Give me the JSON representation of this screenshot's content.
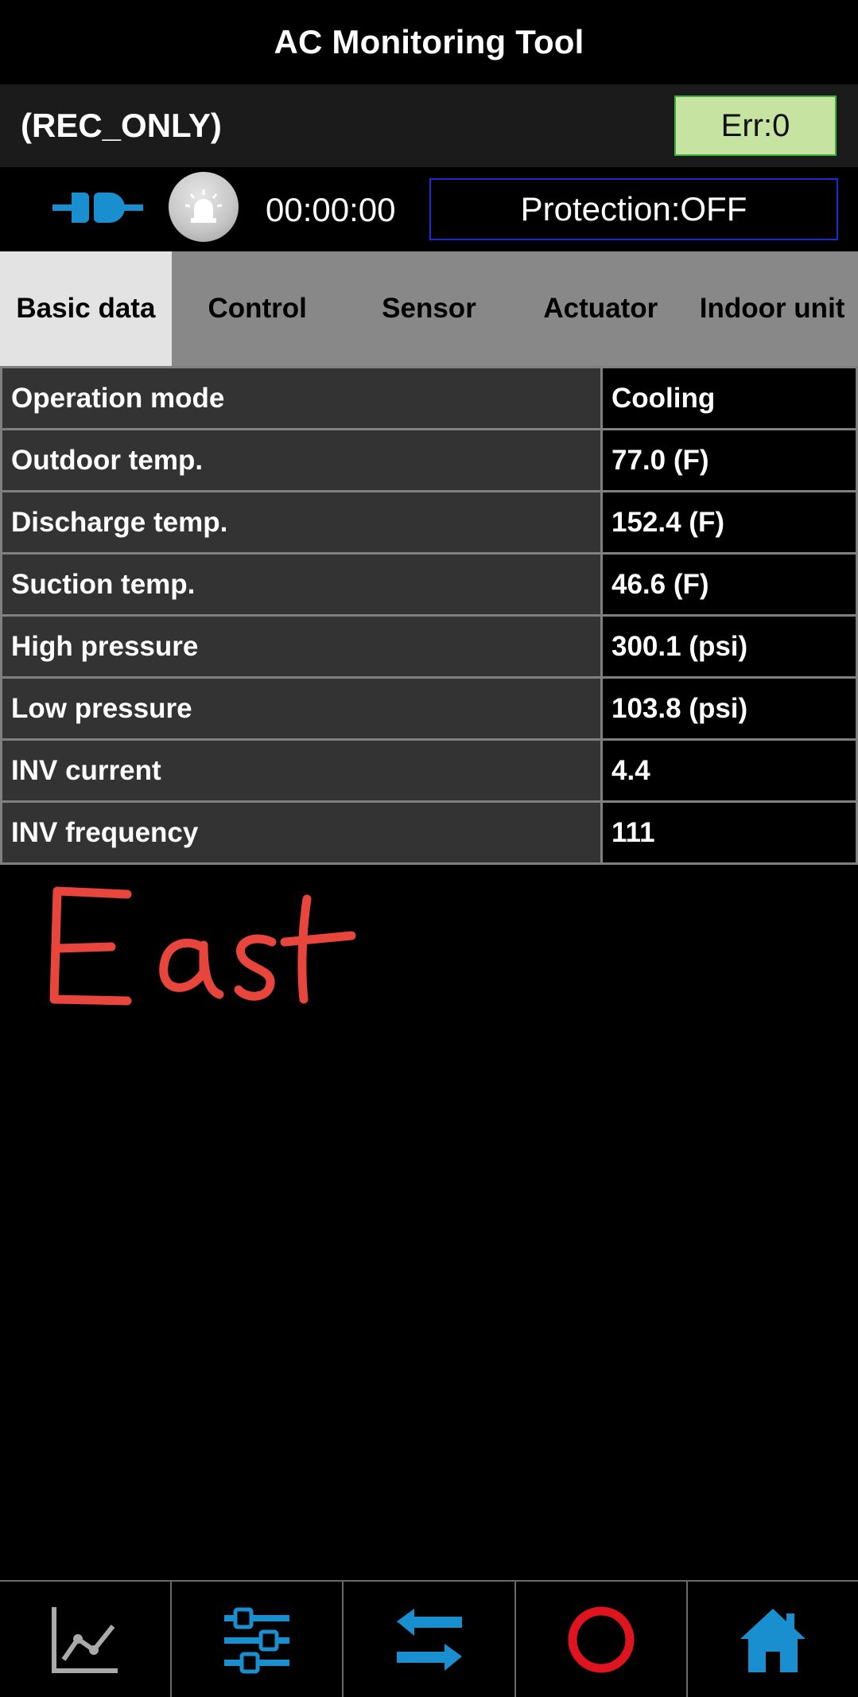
{
  "app": {
    "title": "AC Monitoring Tool"
  },
  "header": {
    "mode": "(REC_ONLY)",
    "error": "Err:0"
  },
  "status": {
    "timer": "00:00:00",
    "protection": "Protection:OFF"
  },
  "tabs": [
    {
      "label": "Basic data",
      "active": true
    },
    {
      "label": "Control",
      "active": false
    },
    {
      "label": "Sensor",
      "active": false
    },
    {
      "label": "Actuator",
      "active": false
    },
    {
      "label": "Indoor unit",
      "active": false
    }
  ],
  "rows": [
    {
      "label": "Operation mode",
      "value": "Cooling"
    },
    {
      "label": "Outdoor temp.",
      "value": "77.0 (F)"
    },
    {
      "label": "Discharge temp.",
      "value": "152.4 (F)"
    },
    {
      "label": "Suction temp.",
      "value": "46.6 (F)"
    },
    {
      "label": "High pressure",
      "value": "300.1 (psi)"
    },
    {
      "label": "Low pressure",
      "value": "103.8 (psi)"
    },
    {
      "label": "INV current",
      "value": "4.4"
    },
    {
      "label": "INV frequency",
      "value": "111"
    }
  ],
  "annotation": {
    "text": "East",
    "color": "#e8453c"
  },
  "colors": {
    "accent_blue": "#1a8fd0",
    "record_red": "#e0141e",
    "err_bg": "#c6e3a1",
    "protection_border": "#1d2bd0"
  },
  "nav": [
    {
      "icon": "graph-icon"
    },
    {
      "icon": "sliders-icon"
    },
    {
      "icon": "swap-arrows-icon"
    },
    {
      "icon": "record-circle-icon"
    },
    {
      "icon": "home-icon"
    }
  ]
}
